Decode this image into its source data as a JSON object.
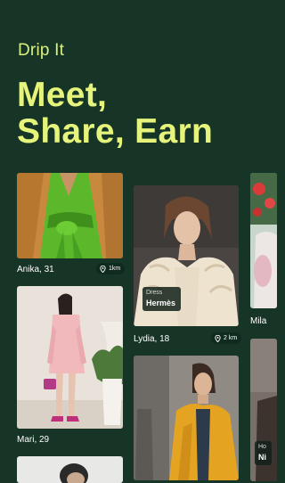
{
  "app": {
    "brand": "Drip It"
  },
  "hero": {
    "line1": "Meet,",
    "line2": "Share, Earn"
  },
  "cards": [
    {
      "name_age": "Anika, 31",
      "distance": "1km"
    },
    {
      "name_age": "Lydia, 18",
      "distance": "2 km",
      "tag": {
        "label": "Dress",
        "value": "Hermès"
      }
    },
    {
      "name_age": "Mari, 29"
    },
    {
      "name_age": "Mila"
    },
    {
      "tag": {
        "label": "Ho",
        "value": "Ni"
      }
    }
  ],
  "colors": {
    "background": "#173527",
    "accent": "#e6f47c",
    "chip": "#0f2a1f"
  },
  "icons": [
    "location-pin-icon"
  ]
}
